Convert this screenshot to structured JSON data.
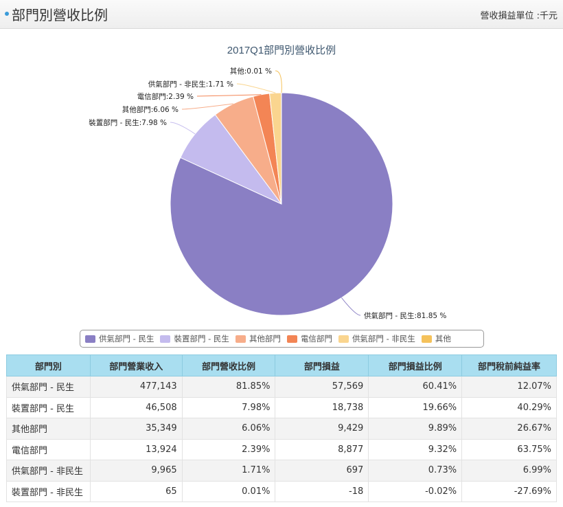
{
  "header": {
    "title": "部門別營收比例",
    "unit_label": "營收損益單位 :千元"
  },
  "chart_data": {
    "type": "pie",
    "title": "2017Q1部門別營收比例",
    "slices": [
      {
        "name": "供氣部門 - 民生",
        "value": 81.85,
        "label": "供氣部門 - 民生:81.85 %",
        "color": "#8a7fc4"
      },
      {
        "name": "裝置部門 - 民生",
        "value": 7.98,
        "label": "裝置部門 - 民生:7.98 %",
        "color": "#c4bbee"
      },
      {
        "name": "其他部門",
        "value": 6.06,
        "label": "其他部門:6.06 %",
        "color": "#f7ad8a"
      },
      {
        "name": "電信部門",
        "value": 2.39,
        "label": "電信部門:2.39 %",
        "color": "#f38555"
      },
      {
        "name": "供氣部門 - 非民生",
        "value": 1.71,
        "label": "供氣部門 - 非民生:1.71 %",
        "color": "#fad58f"
      },
      {
        "name": "其他",
        "value": 0.01,
        "label": "其他:0.01 %",
        "color": "#f5c25b"
      }
    ],
    "legend_position": "bottom"
  },
  "table": {
    "headers": [
      "部門別",
      "部門營業收入",
      "部門營收比例",
      "部門損益",
      "部門損益比例",
      "部門稅前純益率"
    ],
    "rows": [
      {
        "name": "供氣部門 - 民生",
        "revenue": "477,143",
        "revenue_ratio": "81.85%",
        "profit": "57,569",
        "profit_ratio": "60.41%",
        "margin": "12.07%",
        "neg": false
      },
      {
        "name": "裝置部門 - 民生",
        "revenue": "46,508",
        "revenue_ratio": "7.98%",
        "profit": "18,738",
        "profit_ratio": "19.66%",
        "margin": "40.29%",
        "neg": false
      },
      {
        "name": "其他部門",
        "revenue": "35,349",
        "revenue_ratio": "6.06%",
        "profit": "9,429",
        "profit_ratio": "9.89%",
        "margin": "26.67%",
        "neg": false
      },
      {
        "name": "電信部門",
        "revenue": "13,924",
        "revenue_ratio": "2.39%",
        "profit": "8,877",
        "profit_ratio": "9.32%",
        "margin": "63.75%",
        "neg": false
      },
      {
        "name": "供氣部門 - 非民生",
        "revenue": "9,965",
        "revenue_ratio": "1.71%",
        "profit": "697",
        "profit_ratio": "0.73%",
        "margin": "6.99%",
        "neg": false
      },
      {
        "name": "裝置部門 - 非民生",
        "revenue": "65",
        "revenue_ratio": "0.01%",
        "profit": "-18",
        "profit_ratio": "-0.02%",
        "margin": "-27.69%",
        "neg": true
      }
    ]
  }
}
